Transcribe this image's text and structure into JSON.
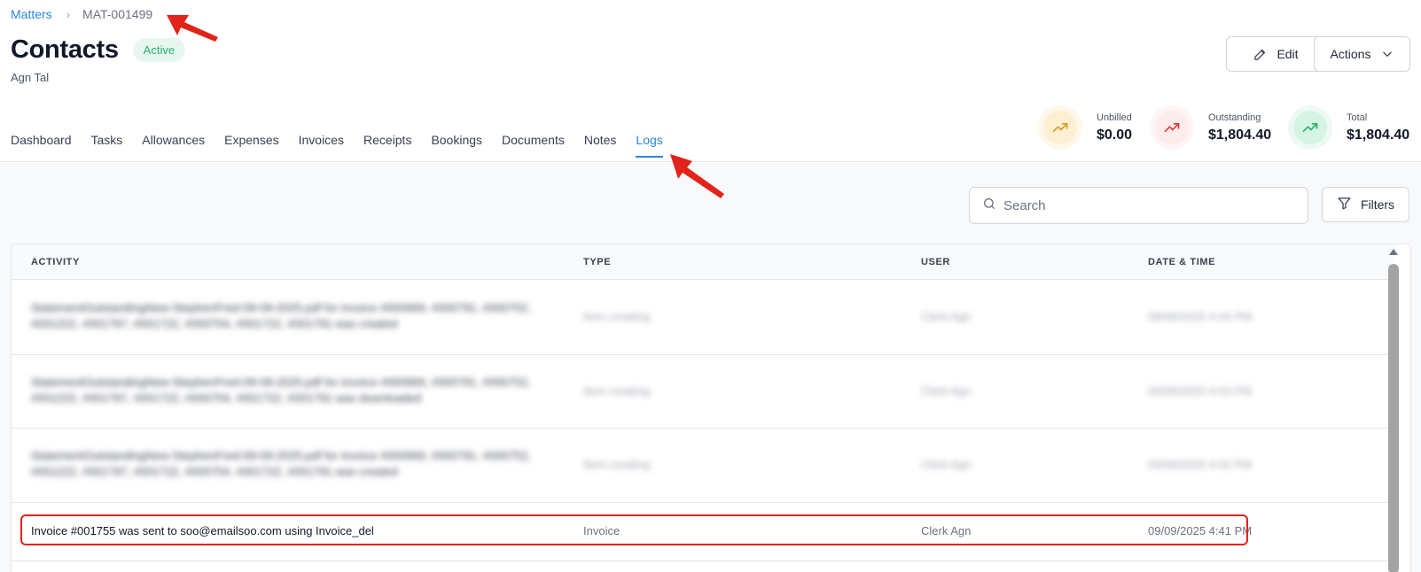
{
  "breadcrumb": {
    "parent": "Matters",
    "current": "MAT-001499"
  },
  "header": {
    "title": "Contacts",
    "status": "Active",
    "subtitle": "Agn Tal",
    "edit_label": "Edit",
    "actions_label": "Actions"
  },
  "tabs": [
    {
      "label": "Dashboard"
    },
    {
      "label": "Tasks"
    },
    {
      "label": "Allowances"
    },
    {
      "label": "Expenses"
    },
    {
      "label": "Invoices"
    },
    {
      "label": "Receipts"
    },
    {
      "label": "Bookings"
    },
    {
      "label": "Documents"
    },
    {
      "label": "Notes"
    },
    {
      "label": "Logs",
      "active": true
    }
  ],
  "stats": {
    "unbilled": {
      "label": "Unbilled",
      "value": "$0.00",
      "icon": "trending-up-icon",
      "color": "#d69a2d",
      "bg": "#fdf3dc"
    },
    "outstanding": {
      "label": "Outstanding",
      "value": "$1,804.40",
      "icon": "trending-up-icon",
      "color": "#e23b3b",
      "bg": "#fdecec"
    },
    "total": {
      "label": "Total",
      "value": "$1,804.40",
      "icon": "trending-up-icon",
      "color": "#27b36a",
      "bg": "#dff6ea"
    }
  },
  "toolbar": {
    "search_placeholder": "Search",
    "filters_label": "Filters"
  },
  "table": {
    "columns": [
      "ACTIVITY",
      "TYPE",
      "USER",
      "DATE & TIME"
    ],
    "rows": [
      {
        "activity": "StatementOutstandingNew-StephenFred-09-09-2025.pdf for invoice #000969, #000791, #000752, #001222, #001797, #001722, #000754, #001722, #001791 was created",
        "type": "Item creating",
        "user": "Clerk Agn",
        "date": "09/09/2025 4:44 PM",
        "blurred": true
      },
      {
        "activity": "StatementOutstandingNew-StephenFred-09-09-2025.pdf for invoice #000969, #000791, #000752, #001222, #001797, #001722, #000754, #001722, #001791 was downloaded",
        "type": "Item creating",
        "user": "Clerk Agn",
        "date": "09/09/2025 4:43 PM",
        "blurred": true
      },
      {
        "activity": "StatementOutstandingNew-StephenFred-09-09-2025.pdf for invoice #000969, #000791, #000752, #001222, #001797, #001722, #000754, #001722, #001791 was created",
        "type": "Item creating",
        "user": "Clerk Agn",
        "date": "09/09/2025 4:42 PM",
        "blurred": true
      },
      {
        "activity": "Invoice #001755 was sent to soo@emailsoo.com using Invoice_del",
        "type": "Invoice",
        "user": "Clerk Agn",
        "date": "09/09/2025 4:41 PM",
        "blurred": false,
        "highlighted": true
      }
    ]
  },
  "colors": {
    "accent": "#2b86d9",
    "annotation_red": "#e2231a"
  }
}
